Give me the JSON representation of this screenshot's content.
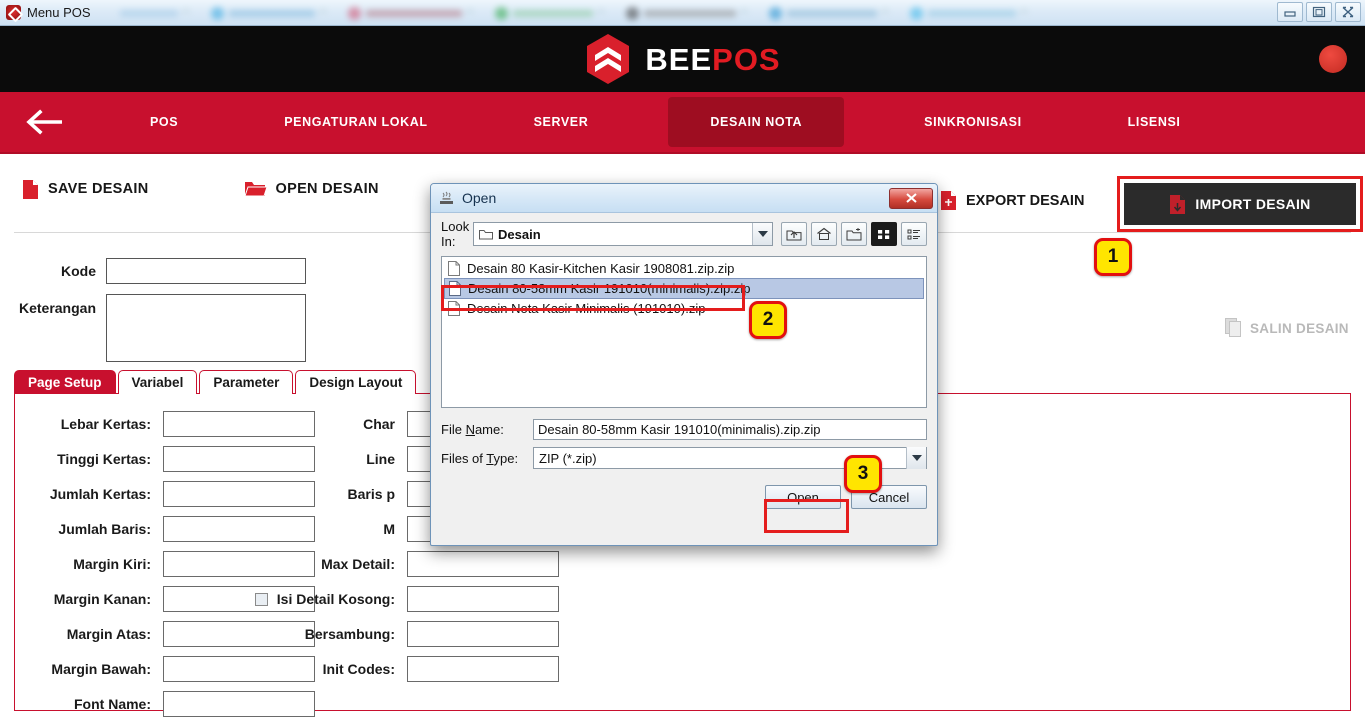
{
  "window": {
    "title": "Menu POS",
    "app_icon": "beepos-icon",
    "controls": [
      {
        "name": "minimize-button",
        "glyph": "minimize-icon"
      },
      {
        "name": "restore-button",
        "glyph": "restore-icon"
      },
      {
        "name": "close-button",
        "glyph": "close-icon"
      }
    ]
  },
  "header": {
    "brand_first": "BEE",
    "brand_second": "POS",
    "logo_icon": "beepos-hexagon-logo",
    "avatar_icon": "user-avatar",
    "avatar_color": "#d8372c"
  },
  "nav": {
    "back_icon": "arrow-left-icon",
    "accent": "#c8102e",
    "active_bg": "#9e0d21",
    "items": [
      {
        "label": "POS",
        "active": false
      },
      {
        "label": "PENGATURAN LOKAL",
        "active": false
      },
      {
        "label": "SERVER",
        "active": false
      },
      {
        "label": "DESAIN NOTA",
        "active": true
      },
      {
        "label": "SINKRONISASI",
        "active": false
      },
      {
        "label": "LISENSI",
        "active": false
      }
    ]
  },
  "toolbar": {
    "save_label": "SAVE DESAIN",
    "save_icon": "file-red-icon",
    "open_label": "OPEN DESAIN",
    "open_icon": "folder-open-red-icon",
    "export_label": "EXPORT DESAIN",
    "export_icon": "file-export-red-icon",
    "import_label": "IMPORT DESAIN",
    "import_icon": "file-import-red-icon",
    "salin_label": "SALIN DESAIN",
    "salin_icon": "copy-pages-icon"
  },
  "form": {
    "kode_label": "Kode",
    "kode_value": "",
    "keterangan_label": "Keterangan",
    "keterangan_value": ""
  },
  "tabs": [
    {
      "label": "Page Setup",
      "active": true
    },
    {
      "label": "Variabel",
      "active": false
    },
    {
      "label": "Parameter",
      "active": false
    },
    {
      "label": "Design Layout",
      "active": false
    }
  ],
  "page_setup": {
    "column_left": [
      {
        "label": "Lebar Kertas:",
        "value": ""
      },
      {
        "label": "Tinggi Kertas:",
        "value": ""
      },
      {
        "label": "Jumlah Kertas:",
        "value": ""
      },
      {
        "label": "Jumlah Baris:",
        "value": ""
      },
      {
        "label": "Margin Kiri:",
        "value": ""
      },
      {
        "label": "Margin Kanan:",
        "value": ""
      },
      {
        "label": "Margin Atas:",
        "value": ""
      },
      {
        "label": "Margin Bawah:",
        "value": ""
      },
      {
        "label": "Font Name:",
        "value": ""
      }
    ],
    "column_right": [
      {
        "label": "Char",
        "value": "",
        "occluded": true
      },
      {
        "label": "Line",
        "value": "",
        "occluded": true
      },
      {
        "label": "Baris p",
        "value": "",
        "occluded": true
      },
      {
        "label": "M",
        "value": "",
        "occluded": true
      },
      {
        "label": "Max Detail:",
        "value": "",
        "occluded": false
      },
      {
        "label": "Isi Detail Kosong:",
        "value": "",
        "occluded": false,
        "checkbox": true,
        "checked": false
      },
      {
        "label": "Bersambung:",
        "value": "",
        "occluded": false
      },
      {
        "label": "Init Codes:",
        "value": "",
        "occluded": false
      }
    ]
  },
  "dialog": {
    "title": "Open",
    "title_icon": "java-coffee-icon",
    "close_icon": "close-x-icon",
    "look_in_label": "Look In:",
    "look_in_value": "Desain",
    "look_in_icon": "folder-icon",
    "toolbar_icons": [
      {
        "name": "up-one-level-icon",
        "selected": false
      },
      {
        "name": "home-icon",
        "selected": false
      },
      {
        "name": "new-folder-icon",
        "selected": false
      },
      {
        "name": "list-view-icon",
        "selected": true
      },
      {
        "name": "details-view-icon",
        "selected": false
      }
    ],
    "files": [
      {
        "name": "Desain 80 Kasir-Kitchen Kasir 1908081.zip.zip",
        "selected": false
      },
      {
        "name": "Desain 80-58mm Kasir 191010(minimalis).zip.zip",
        "selected": true
      },
      {
        "name": "Desain Nota Kasir Minimalis (191010).zip",
        "selected": false
      }
    ],
    "file_name_label_pre": "File ",
    "file_name_label_underlined": "N",
    "file_name_label_post": "ame:",
    "file_name_value": "Desain 80-58mm Kasir 191010(minimalis).zip.zip",
    "files_of_type_label_pre": "Files of ",
    "files_of_type_label_underlined": "T",
    "files_of_type_label_post": "ype:",
    "files_of_type_value": "ZIP (*.zip)",
    "open_button": "Open",
    "cancel_button": "Cancel"
  },
  "annotations": {
    "highlight_color": "#e41d1d",
    "badge_bg": "#ffe500",
    "badges": [
      {
        "id": "step-1",
        "label": "1"
      },
      {
        "id": "step-2",
        "label": "2"
      },
      {
        "id": "step-3",
        "label": "3"
      }
    ]
  }
}
